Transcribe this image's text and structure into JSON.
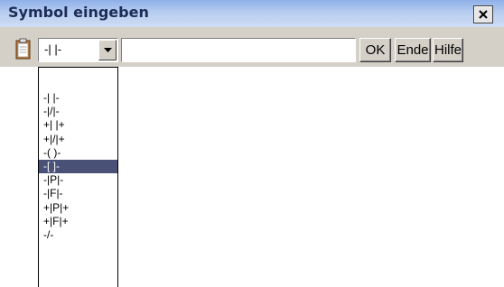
{
  "window": {
    "title": "Symbol eingeben",
    "close_icon": "close-icon"
  },
  "toolbar": {
    "clipboard_icon": "clipboard-icon",
    "symbol_select": {
      "value": "-| |-",
      "arrow_icon": "dropdown-arrow-icon"
    },
    "text_input": {
      "value": "",
      "placeholder": ""
    },
    "ok_label": "OK",
    "ende_label": "Ende",
    "hilfe_label": "Hilfe"
  },
  "dropdown": {
    "items": [
      {
        "label": "-| |-",
        "selected": false
      },
      {
        "label": "-|/|-",
        "selected": false
      },
      {
        "label": "+| |+",
        "selected": false
      },
      {
        "label": "+|/|+",
        "selected": false
      },
      {
        "label": "-( )-",
        "selected": false
      },
      {
        "label": "-[ ]-",
        "selected": true
      },
      {
        "label": "-|P|-",
        "selected": false
      },
      {
        "label": "-|F|-",
        "selected": false
      },
      {
        "label": "+|P|+",
        "selected": false
      },
      {
        "label": "+|F|+",
        "selected": false
      },
      {
        "label": "-/-",
        "selected": false
      }
    ]
  },
  "colors": {
    "title_text": "#1c2c55",
    "selection_bg": "#4a5177",
    "selection_text": "#ffffff",
    "dialog_bg": "#d4d0c8"
  }
}
